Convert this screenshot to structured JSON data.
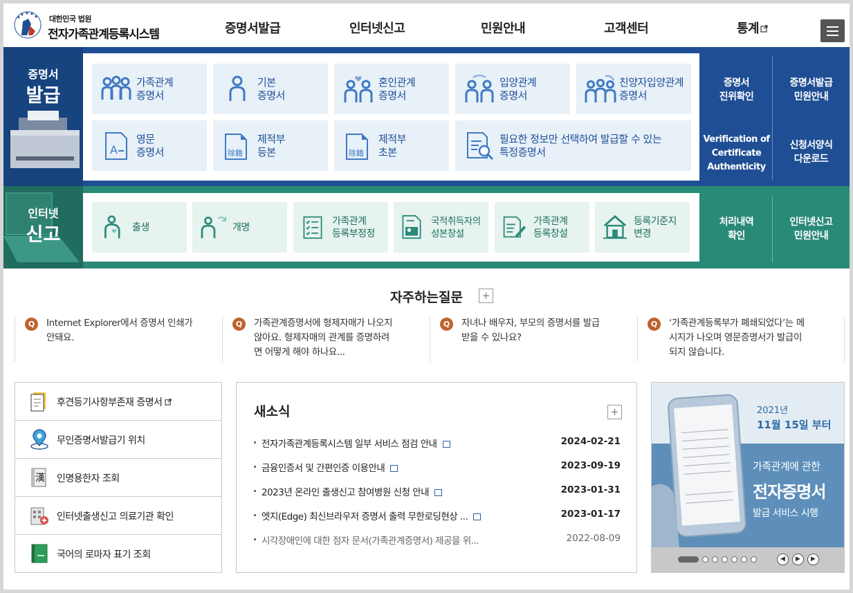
{
  "header": {
    "emblem_alt": "court-emblem",
    "org": "대한민국 법원",
    "title": "전자가족관계등록시스템",
    "nav": [
      "증명서발급",
      "인터넷신고",
      "민원안내",
      "고객센터",
      "통계"
    ],
    "menu_icon": "hamburger-icon"
  },
  "issue": {
    "label_small": "증명서",
    "label_big": "발급",
    "cards": [
      {
        "label": "가족관계\n증명서",
        "icon": "family-icon"
      },
      {
        "label": "기본\n증명서",
        "icon": "person-icon"
      },
      {
        "label": "혼인관계\n증명서",
        "icon": "couple-heart-icon"
      },
      {
        "label": "입양관계\n증명서",
        "icon": "adoption-icon"
      },
      {
        "label": "친양자입양관계\n증명서",
        "icon": "full-adoption-icon"
      },
      {
        "label": "영문\n증명서",
        "icon": "english-document-icon"
      },
      {
        "label": "제적부\n등본",
        "icon": "removed-register-icon"
      },
      {
        "label": "제적부\n초본",
        "icon": "removed-register-icon"
      },
      {
        "label": "필요한 정보만 선택하여 발급할 수 있는\n특정증명서",
        "icon": "search-document-icon"
      }
    ],
    "side_links": [
      "증명서\n진위확인",
      "증명서발급\n민원안내",
      "Verification of\nCertificate\nAuthenticity",
      "신청서양식\n다운로드"
    ]
  },
  "report": {
    "label_small": "인터넷",
    "label_big": "신고",
    "cards": [
      {
        "label": "출생",
        "icon": "birth-icon"
      },
      {
        "label": "개명",
        "icon": "rename-icon"
      },
      {
        "label": "가족관계\n등록부정정",
        "icon": "checklist-icon"
      },
      {
        "label": "국적취득자의\n성본창설",
        "icon": "nationality-icon"
      },
      {
        "label": "가족관계\n등록창설",
        "icon": "register-create-icon"
      },
      {
        "label": "등록기준지\n변경",
        "icon": "house-icon"
      }
    ],
    "side_links": [
      "처리내역\n확인",
      "인터넷신고\n민원안내"
    ]
  },
  "faq": {
    "title": "자주하는질문",
    "badge": "Q",
    "items": [
      "Internet Explorer에서 증명서 인쇄가\n안돼요.",
      "가족관계증명서에 형제자매가 나오지\n않아요. 형제자매의 관계를 증명하려\n면 어떻게 해야 하나요...",
      "자녀나 배우자, 부모의 증명서를 발급\n받을 수 있나요?",
      "‘가족관계등록부가 폐쇄되었다’는 메\n시지가 나오며 영문증명서가 발급이\n되지 않습니다."
    ]
  },
  "quick": [
    {
      "label": "후견등기사항부존재 증명서",
      "icon": "document-icon",
      "external": true
    },
    {
      "label": "무인증명서발급기 위치",
      "icon": "location-icon"
    },
    {
      "label": "인명용한자 조회",
      "icon": "hanja-book-icon"
    },
    {
      "label": "인터넷출생신고 의료기관 확인",
      "icon": "hospital-icon"
    },
    {
      "label": "국어의 로마자 표기 조회",
      "icon": "green-book-icon"
    }
  ],
  "news": {
    "title": "새소식",
    "items": [
      {
        "title": "전자가족관계등록시스템 일부 서비스 점검 안내",
        "date": "2024-02-21",
        "new": true
      },
      {
        "title": "금융인증서 및 간편인증 이용안내",
        "date": "2023-09-19",
        "new": true
      },
      {
        "title": "2023년 온라인 출생신고 참여병원 신청 안내",
        "date": "2023-01-31",
        "new": true
      },
      {
        "title": "엣지(Edge) 최신브라우저 증명서 출력 무한로딩현상 ...",
        "date": "2023-01-17",
        "new": true
      },
      {
        "title": "시각장애인에 대한 점자 문서(가족관계증명서) 제공을 위...",
        "date": "2022-08-09",
        "new": false
      }
    ]
  },
  "banner": {
    "year": "2021년",
    "date": "11월 15일 부터",
    "line1": "가족관계에 관한",
    "line2": "전자증명서",
    "line3": "발급 서비스 시행",
    "pages": 8,
    "active_page": 1
  },
  "colors": {
    "blue": "#1f4e94",
    "teal": "#2a8a78",
    "accent": "#c0612b"
  }
}
